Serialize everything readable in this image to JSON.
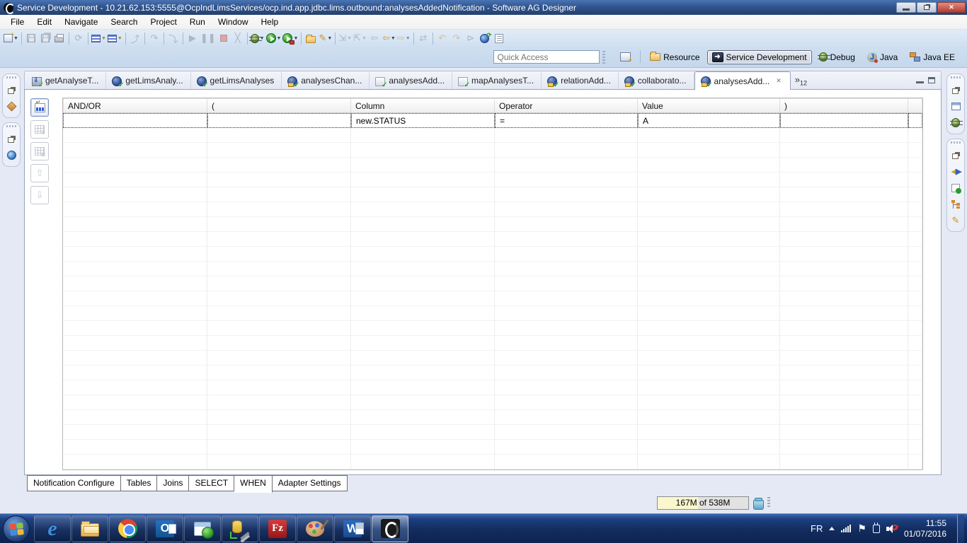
{
  "window": {
    "title": "Service Development - 10.21.62.153:5555@OcpIndLimsServices/ocp.ind.app.jdbc.lims.outbound:analysesAddedNotification - Software AG Designer",
    "controls": {
      "minimize": "minimize",
      "restore": "restore",
      "close": "close"
    }
  },
  "menu": {
    "items": [
      "File",
      "Edit",
      "Navigate",
      "Search",
      "Project",
      "Run",
      "Window",
      "Help"
    ]
  },
  "toolbar": {
    "icons": [
      "new-wizard",
      "save",
      "save-all",
      "print",
      "build",
      "insert-step",
      "append-step",
      "step-return",
      "refresh-run",
      "step-into",
      "resume",
      "suspend",
      "terminate",
      "disconnect",
      "debug",
      "run",
      "run-locked",
      "open-folder",
      "highlight-pen",
      "next-annotation",
      "previous-annotation",
      "last-edit-location",
      "back",
      "forward",
      "link-with-editor",
      "undo",
      "redo",
      "run-to-line",
      "web-services-explorer",
      "show-console"
    ]
  },
  "quick_access": {
    "placeholder": "Quick Access"
  },
  "perspectives": {
    "items": [
      {
        "label": "Resource"
      },
      {
        "label": "Service Development"
      },
      {
        "label": "Debug"
      },
      {
        "label": "Java"
      },
      {
        "label": "Java EE"
      }
    ],
    "active": "Service Development"
  },
  "editor_tabs": {
    "tabs": [
      {
        "label": "getAnalyseT..."
      },
      {
        "label": "getLimsAnaly..."
      },
      {
        "label": "getLimsAnalyses"
      },
      {
        "label": "analysesChan..."
      },
      {
        "label": "analysesAdd..."
      },
      {
        "label": "mapAnalysesT..."
      },
      {
        "label": "relationAdd..."
      },
      {
        "label": "collaborato..."
      },
      {
        "label": "analysesAdd..."
      }
    ],
    "active_index": 8,
    "overflow_chevron": "»",
    "overflow_count": "12"
  },
  "query_editor": {
    "headers": [
      "AND/OR",
      "(",
      "Column",
      "Operator",
      "Value",
      ")"
    ],
    "row": {
      "and_or": "",
      "open_paren": "",
      "column": "new.STATUS",
      "operator": "=",
      "value": "A",
      "close_paren": ""
    },
    "empty_rows": 23,
    "side_buttons": [
      "insert-row",
      "add-row",
      "delete-row",
      "move-row-up",
      "move-row-down"
    ]
  },
  "bottom_tabs": {
    "tabs": [
      "Notification Configure",
      "Tables",
      "Joins",
      "SELECT",
      "WHEN",
      "Adapter Settings"
    ],
    "active": "WHEN"
  },
  "status_bar": {
    "heap": "167M of 538M"
  },
  "left_rail": {
    "groups": [
      [
        "restore-pane",
        "package-navigator"
      ],
      [
        "restore-pane",
        "web-browser"
      ]
    ]
  },
  "right_rail": {
    "groups": [
      [
        "restore-pane",
        "properties-view",
        "debug-view"
      ],
      [
        "restore-pane",
        "synchronize",
        "launch-view",
        "outline-view",
        "highlight-pen"
      ]
    ]
  },
  "taskbar": {
    "apps": [
      "start",
      "internet-explorer",
      "windows-explorer",
      "chrome",
      "outlook",
      "database-viewer",
      "admin-tool",
      "filezilla",
      "paint",
      "word",
      "software-ag-designer"
    ],
    "active_app": "software-ag-designer",
    "tray": {
      "language": "FR",
      "time": "11:55",
      "date": "01/07/2016",
      "icons": [
        "show-hidden-icons",
        "network-signal",
        "action-flag",
        "power-plug",
        "volume-muted"
      ]
    }
  }
}
